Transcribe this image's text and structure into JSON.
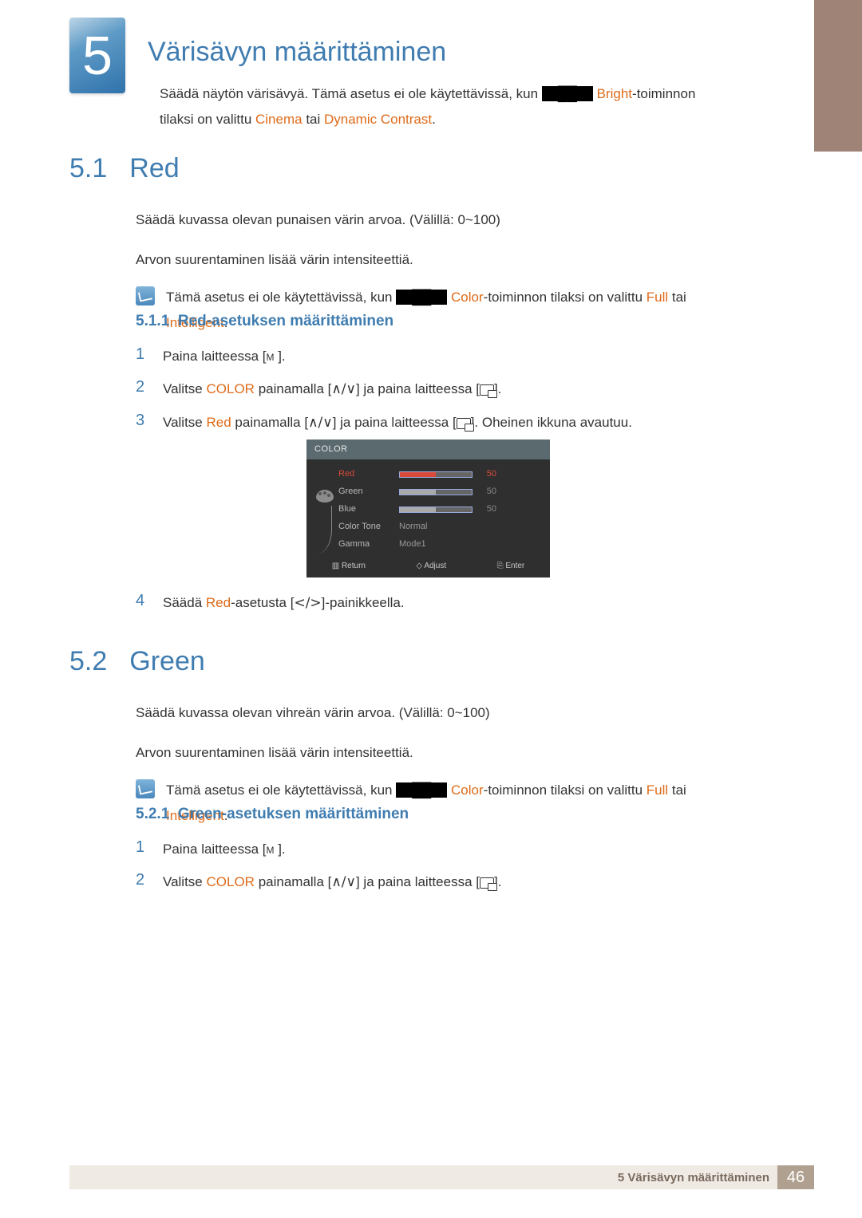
{
  "chapter": {
    "number": "5",
    "title": "Värisävyn määrittäminen"
  },
  "intro": {
    "part1": "Säädä näytön värisävyä. Tämä asetus ei ole käytettävissä, kun ",
    "bright": "Bright",
    "part2": "-toiminnon tilaksi on valittu ",
    "cinema": "Cinema",
    "or": " tai ",
    "dynamic": "Dynamic Contrast",
    "end": "."
  },
  "sec51": {
    "num": "5.1",
    "title": "Red",
    "p1": "Säädä kuvassa olevan punaisen värin arvoa. (Välillä: 0~100)",
    "p2": "Arvon suurentaminen lisää värin intensiteettiä.",
    "note": {
      "part1": "Tämä asetus ei ole käytettävissä, kun ",
      "color": "Color",
      "part2": "-toiminnon tilaksi on valittu ",
      "full": "Full",
      "or": " tai ",
      "intel": "Intelligent",
      "end": "."
    },
    "sub": {
      "num": "5.1.1",
      "title": "Red-asetuksen määrittäminen"
    },
    "steps": {
      "s1": "Paina laitteessa [",
      "s1_key": "m",
      "s1_end": "].",
      "s2a": "Valitse ",
      "s2_color": "COLOR",
      "s2b": " painamalla [",
      "s2_arrows": "∧/∨",
      "s2c": "] ja paina laitteessa [",
      "s2d": "].",
      "s3a": "Valitse ",
      "s3_red": "Red",
      "s3b": " painamalla [",
      "s3c": "] ja paina laitteessa [",
      "s3d": "]. Oheinen ikkuna avautuu.",
      "s4a": "Säädä ",
      "s4_red": "Red",
      "s4b": "-asetusta [",
      "s4_lr": "</>",
      "s4c": "]-painikkeella."
    }
  },
  "osd": {
    "title": "COLOR",
    "rows": [
      {
        "label": "Red",
        "value": "50",
        "selected": true,
        "bar": true
      },
      {
        "label": "Green",
        "value": "50",
        "selected": false,
        "bar": true
      },
      {
        "label": "Blue",
        "value": "50",
        "selected": false,
        "bar": true
      },
      {
        "label": "Color Tone",
        "value": "Normal",
        "selected": false,
        "bar": false
      },
      {
        "label": "Gamma",
        "value": "Mode1",
        "selected": false,
        "bar": false
      }
    ],
    "footer": {
      "return": "Return",
      "adjust": "Adjust",
      "enter": "Enter"
    }
  },
  "sec52": {
    "num": "5.2",
    "title": "Green",
    "p1": "Säädä kuvassa olevan vihreän värin arvoa. (Välillä: 0~100)",
    "p2": "Arvon suurentaminen lisää värin intensiteettiä.",
    "note": {
      "part1": "Tämä asetus ei ole käytettävissä, kun ",
      "color": "Color",
      "part2": "-toiminnon tilaksi on valittu ",
      "full": "Full",
      "or": " tai ",
      "intel": "Intelligent",
      "end": "."
    },
    "sub": {
      "num": "5.2.1",
      "title": "Green-asetuksen määrittäminen"
    },
    "steps": {
      "s1": "Paina laitteessa [",
      "s1_key": "m",
      "s1_end": "].",
      "s2a": "Valitse ",
      "s2_color": "COLOR",
      "s2b": " painamalla [",
      "s2_arrows": "∧/∨",
      "s2c": "] ja paina laitteessa [",
      "s2d": "]."
    }
  },
  "footer": {
    "text": "5 Värisävyn määrittäminen",
    "page": "46"
  }
}
